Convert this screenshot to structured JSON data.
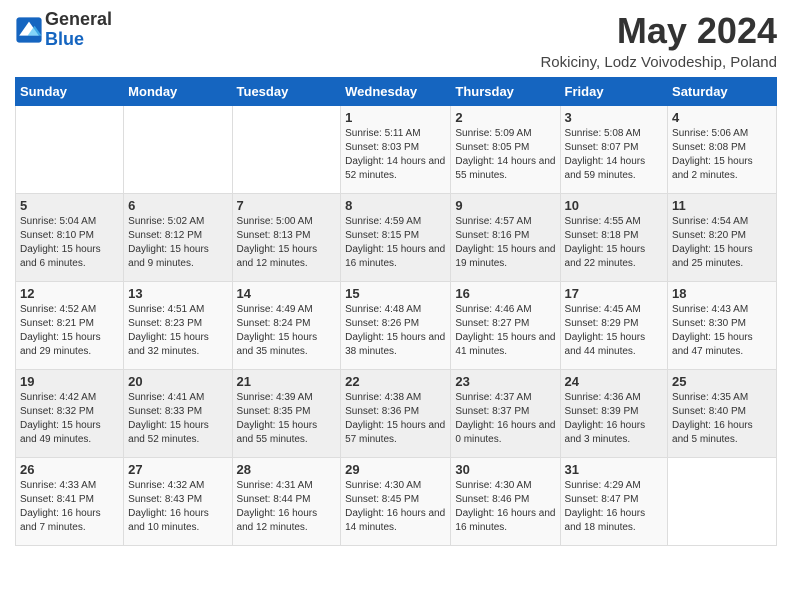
{
  "header": {
    "logo_general": "General",
    "logo_blue": "Blue",
    "title": "May 2024",
    "subtitle": "Rokiciny, Lodz Voivodeship, Poland"
  },
  "weekdays": [
    "Sunday",
    "Monday",
    "Tuesday",
    "Wednesday",
    "Thursday",
    "Friday",
    "Saturday"
  ],
  "weeks": [
    [
      {
        "day": "",
        "info": ""
      },
      {
        "day": "",
        "info": ""
      },
      {
        "day": "",
        "info": ""
      },
      {
        "day": "1",
        "info": "Sunrise: 5:11 AM\nSunset: 8:03 PM\nDaylight: 14 hours and 52 minutes."
      },
      {
        "day": "2",
        "info": "Sunrise: 5:09 AM\nSunset: 8:05 PM\nDaylight: 14 hours and 55 minutes."
      },
      {
        "day": "3",
        "info": "Sunrise: 5:08 AM\nSunset: 8:07 PM\nDaylight: 14 hours and 59 minutes."
      },
      {
        "day": "4",
        "info": "Sunrise: 5:06 AM\nSunset: 8:08 PM\nDaylight: 15 hours and 2 minutes."
      }
    ],
    [
      {
        "day": "5",
        "info": "Sunrise: 5:04 AM\nSunset: 8:10 PM\nDaylight: 15 hours and 6 minutes."
      },
      {
        "day": "6",
        "info": "Sunrise: 5:02 AM\nSunset: 8:12 PM\nDaylight: 15 hours and 9 minutes."
      },
      {
        "day": "7",
        "info": "Sunrise: 5:00 AM\nSunset: 8:13 PM\nDaylight: 15 hours and 12 minutes."
      },
      {
        "day": "8",
        "info": "Sunrise: 4:59 AM\nSunset: 8:15 PM\nDaylight: 15 hours and 16 minutes."
      },
      {
        "day": "9",
        "info": "Sunrise: 4:57 AM\nSunset: 8:16 PM\nDaylight: 15 hours and 19 minutes."
      },
      {
        "day": "10",
        "info": "Sunrise: 4:55 AM\nSunset: 8:18 PM\nDaylight: 15 hours and 22 minutes."
      },
      {
        "day": "11",
        "info": "Sunrise: 4:54 AM\nSunset: 8:20 PM\nDaylight: 15 hours and 25 minutes."
      }
    ],
    [
      {
        "day": "12",
        "info": "Sunrise: 4:52 AM\nSunset: 8:21 PM\nDaylight: 15 hours and 29 minutes."
      },
      {
        "day": "13",
        "info": "Sunrise: 4:51 AM\nSunset: 8:23 PM\nDaylight: 15 hours and 32 minutes."
      },
      {
        "day": "14",
        "info": "Sunrise: 4:49 AM\nSunset: 8:24 PM\nDaylight: 15 hours and 35 minutes."
      },
      {
        "day": "15",
        "info": "Sunrise: 4:48 AM\nSunset: 8:26 PM\nDaylight: 15 hours and 38 minutes."
      },
      {
        "day": "16",
        "info": "Sunrise: 4:46 AM\nSunset: 8:27 PM\nDaylight: 15 hours and 41 minutes."
      },
      {
        "day": "17",
        "info": "Sunrise: 4:45 AM\nSunset: 8:29 PM\nDaylight: 15 hours and 44 minutes."
      },
      {
        "day": "18",
        "info": "Sunrise: 4:43 AM\nSunset: 8:30 PM\nDaylight: 15 hours and 47 minutes."
      }
    ],
    [
      {
        "day": "19",
        "info": "Sunrise: 4:42 AM\nSunset: 8:32 PM\nDaylight: 15 hours and 49 minutes."
      },
      {
        "day": "20",
        "info": "Sunrise: 4:41 AM\nSunset: 8:33 PM\nDaylight: 15 hours and 52 minutes."
      },
      {
        "day": "21",
        "info": "Sunrise: 4:39 AM\nSunset: 8:35 PM\nDaylight: 15 hours and 55 minutes."
      },
      {
        "day": "22",
        "info": "Sunrise: 4:38 AM\nSunset: 8:36 PM\nDaylight: 15 hours and 57 minutes."
      },
      {
        "day": "23",
        "info": "Sunrise: 4:37 AM\nSunset: 8:37 PM\nDaylight: 16 hours and 0 minutes."
      },
      {
        "day": "24",
        "info": "Sunrise: 4:36 AM\nSunset: 8:39 PM\nDaylight: 16 hours and 3 minutes."
      },
      {
        "day": "25",
        "info": "Sunrise: 4:35 AM\nSunset: 8:40 PM\nDaylight: 16 hours and 5 minutes."
      }
    ],
    [
      {
        "day": "26",
        "info": "Sunrise: 4:33 AM\nSunset: 8:41 PM\nDaylight: 16 hours and 7 minutes."
      },
      {
        "day": "27",
        "info": "Sunrise: 4:32 AM\nSunset: 8:43 PM\nDaylight: 16 hours and 10 minutes."
      },
      {
        "day": "28",
        "info": "Sunrise: 4:31 AM\nSunset: 8:44 PM\nDaylight: 16 hours and 12 minutes."
      },
      {
        "day": "29",
        "info": "Sunrise: 4:30 AM\nSunset: 8:45 PM\nDaylight: 16 hours and 14 minutes."
      },
      {
        "day": "30",
        "info": "Sunrise: 4:30 AM\nSunset: 8:46 PM\nDaylight: 16 hours and 16 minutes."
      },
      {
        "day": "31",
        "info": "Sunrise: 4:29 AM\nSunset: 8:47 PM\nDaylight: 16 hours and 18 minutes."
      },
      {
        "day": "",
        "info": ""
      }
    ]
  ]
}
